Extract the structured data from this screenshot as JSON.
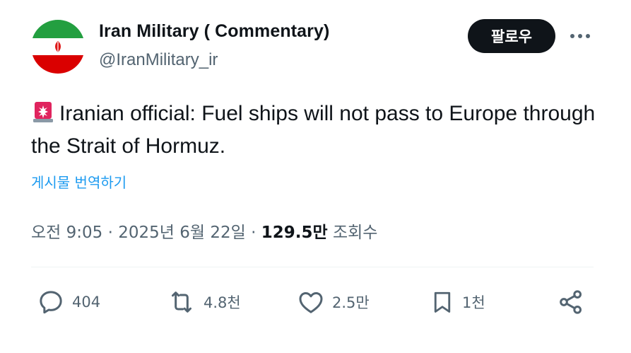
{
  "author": {
    "display_name": "Iran Military ( Commentary)",
    "handle": "@IranMilitary_ir",
    "avatar": "iran-flag-avatar"
  },
  "follow_label": "팔로우",
  "more_icon": "more-dots-icon",
  "tweet": {
    "emoji": "siren-emoji",
    "text": "Iranian official: Fuel ships will not pass to Europe through the Strait of Hormuz.",
    "translate_label": "게시물 번역하기"
  },
  "meta": {
    "time": "오전 9:05",
    "separator": "·",
    "date": "2025년 6월 22일",
    "views_count": "129.5만",
    "views_label": "조회수"
  },
  "actions": {
    "reply": {
      "icon": "reply-icon",
      "count": "404"
    },
    "retweet": {
      "icon": "retweet-icon",
      "count": "4.8천"
    },
    "like": {
      "icon": "heart-icon",
      "count": "2.5만"
    },
    "bookmark": {
      "icon": "bookmark-icon",
      "count": "1천"
    },
    "share": {
      "icon": "share-icon"
    }
  },
  "colors": {
    "text": "#0f1419",
    "secondary": "#536471",
    "link": "#1d9bf0",
    "flag_green": "#239f40",
    "flag_red": "#da0000"
  }
}
